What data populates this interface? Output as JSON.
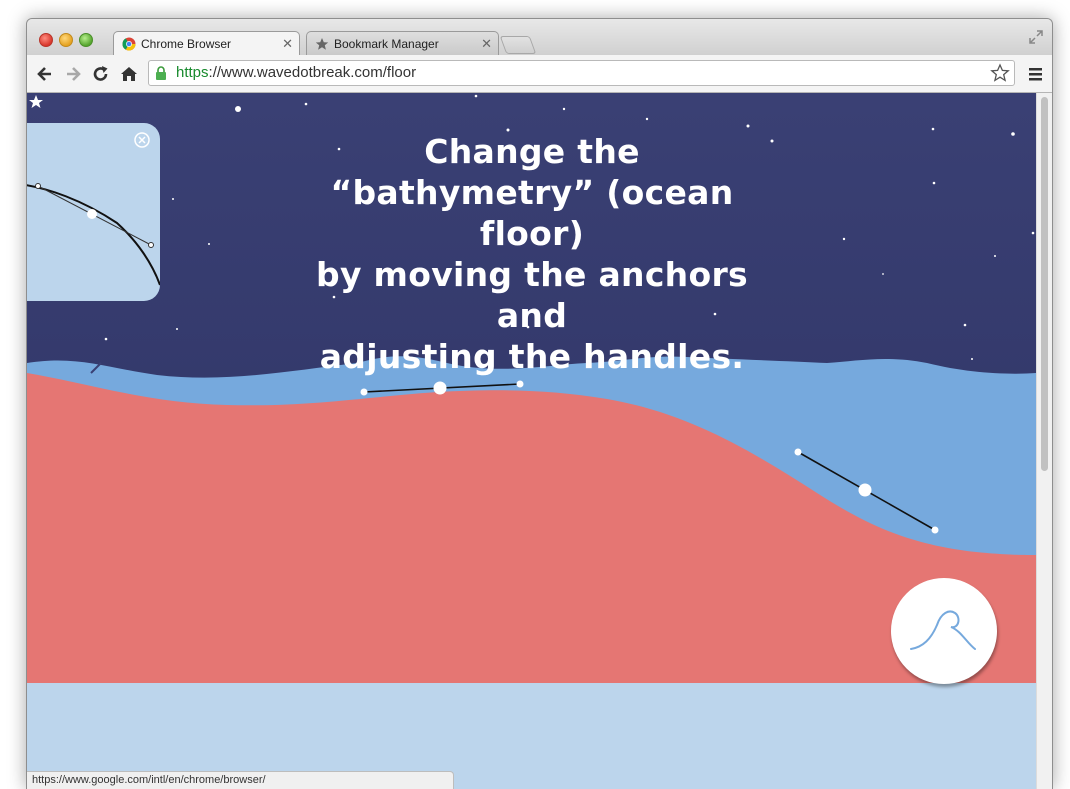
{
  "browser": {
    "tabs": [
      {
        "label": "Chrome Browser",
        "favicon": "chrome-icon",
        "active": true
      },
      {
        "label": "Bookmark Manager",
        "favicon": "star-icon",
        "active": false
      }
    ],
    "url_scheme": "https",
    "url_rest": "://www.wavedotbreak.com/floor",
    "status_url": "https://www.google.com/intl/en/chrome/browser/"
  },
  "page": {
    "headline_lines": [
      "Change the",
      "“bathymetry” (ocean floor)",
      "by moving the anchors and",
      "adjusting the handles."
    ],
    "colors": {
      "sky_top": "#3a4074",
      "sky_bottom": "#2f3566",
      "water": "#76a9dd",
      "floor": "#e57673",
      "below": "#bcd5ec"
    }
  }
}
